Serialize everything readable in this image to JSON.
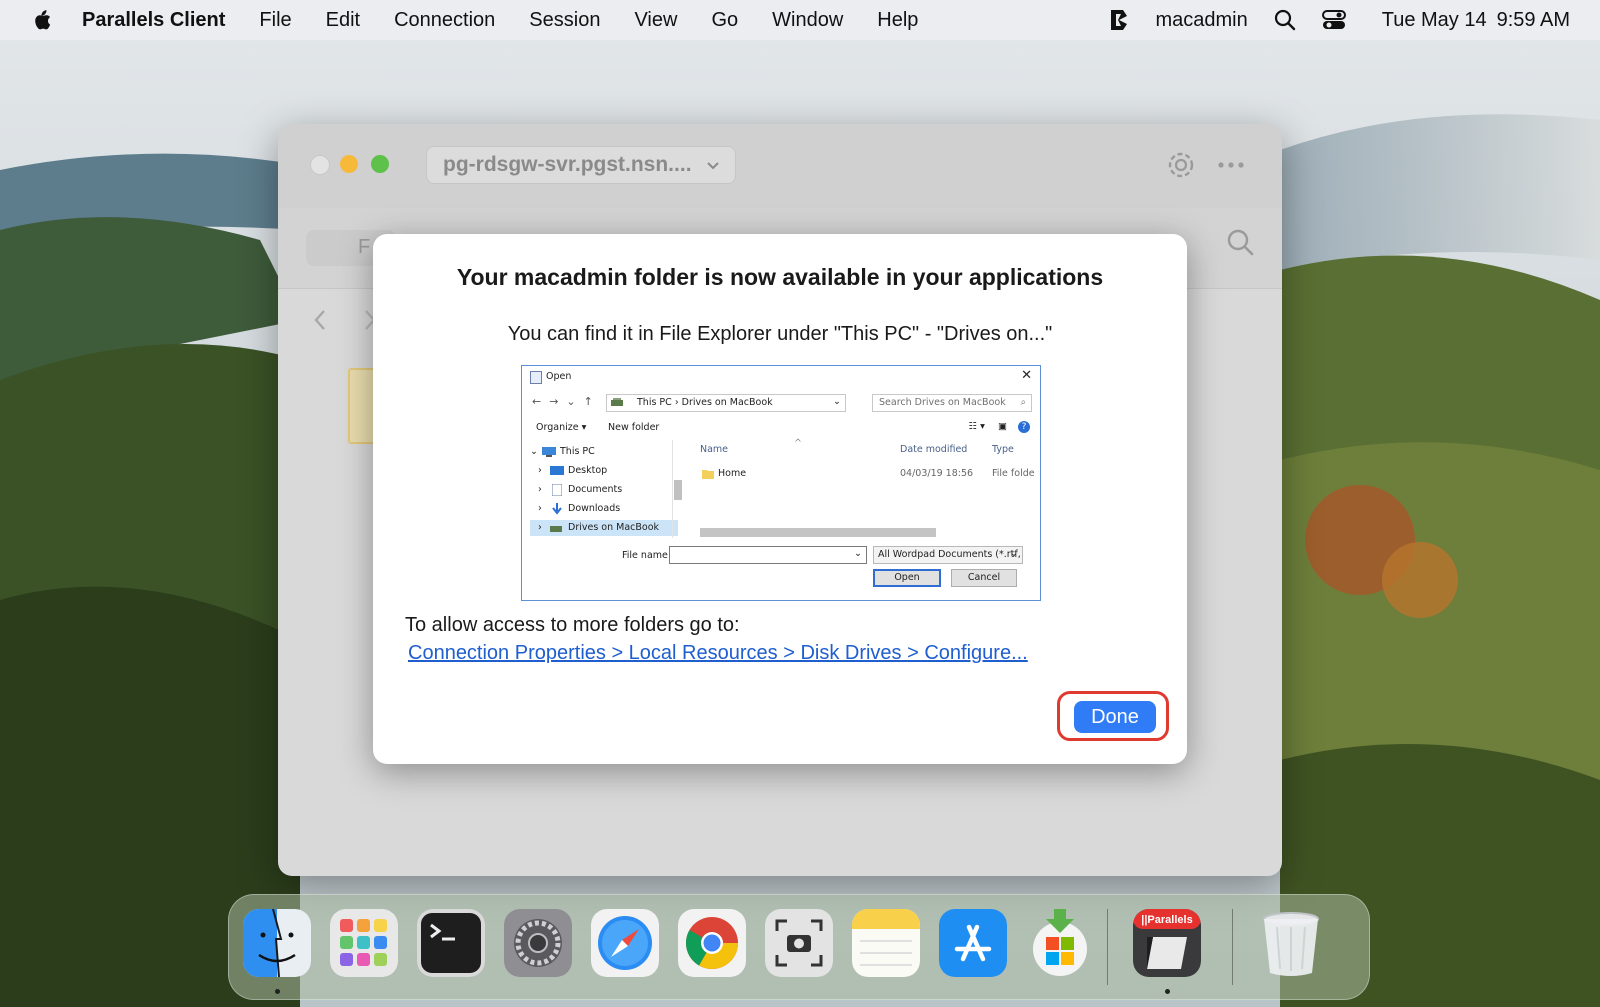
{
  "menubar": {
    "app_name": "Parallels Client",
    "menus": [
      "File",
      "Edit",
      "Connection",
      "Session",
      "View",
      "Go",
      "Window",
      "Help"
    ],
    "user": "macadmin",
    "date": "Tue May 14",
    "time": "9:59 AM"
  },
  "app_window": {
    "host": "pg-rdsgw-svr.pgst.nsn....",
    "tab_partial": "F"
  },
  "dialog": {
    "title": "Your macadmin folder is now available in your applications",
    "subtitle": "You can find it in File Explorer under \"This PC\" - \"Drives on...\"",
    "access_text": "To allow access to more folders go to:",
    "link_text": "Connection Properties > Local Resources > Disk Drives > Configure...",
    "done_label": "Done"
  },
  "explorer_shot": {
    "title": "Open",
    "address": [
      "This PC",
      "Drives on MacBook"
    ],
    "search_placeholder": "Search Drives on MacBook",
    "organize": "Organize",
    "new_folder": "New folder",
    "tree": [
      "This PC",
      "Desktop",
      "Documents",
      "Downloads",
      "Drives on MacBook"
    ],
    "columns": [
      "Name",
      "Date modified",
      "Type"
    ],
    "row": {
      "name": "Home",
      "date": "04/03/19 18:56",
      "type": "File folde"
    },
    "file_name_label": "File name:",
    "file_type": "All Wordpad Documents (*.rtf,",
    "open_label": "Open",
    "cancel_label": "Cancel"
  },
  "dock": {
    "apps": [
      "finder",
      "launchpad",
      "terminal",
      "system-settings",
      "safari",
      "chrome",
      "screenshot",
      "notes",
      "app-store",
      "software-center",
      "parallels-client",
      "trash"
    ],
    "parallels_badge": "||Parallels"
  },
  "colors": {
    "accent": "#2f7cf6",
    "highlight_ring": "#e0392e",
    "link": "#1e5ecf"
  }
}
